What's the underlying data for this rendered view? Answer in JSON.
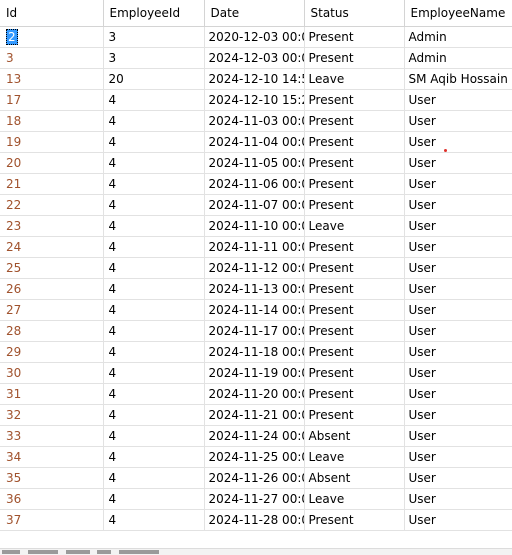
{
  "columns": {
    "id": "Id",
    "employee_id": "EmployeeId",
    "date": "Date",
    "status": "Status",
    "employee_name": "EmployeeName"
  },
  "selected_row": 0,
  "rows": [
    {
      "id": "2",
      "employee_id": "3",
      "date": "2020-12-03 00:0...",
      "status": "Present",
      "employee_name": "Admin"
    },
    {
      "id": "3",
      "employee_id": "3",
      "date": "2024-12-03 00:0...",
      "status": "Present",
      "employee_name": "Admin"
    },
    {
      "id": "13",
      "employee_id": "20",
      "date": "2024-12-10 14:5...",
      "status": "Leave",
      "employee_name": "SM Aqib Hossain"
    },
    {
      "id": "17",
      "employee_id": "4",
      "date": "2024-12-10 15:2...",
      "status": "Present",
      "employee_name": "User"
    },
    {
      "id": "18",
      "employee_id": "4",
      "date": "2024-11-03 00:0...",
      "status": "Present",
      "employee_name": "User"
    },
    {
      "id": "19",
      "employee_id": "4",
      "date": "2024-11-04 00:0...",
      "status": "Present",
      "employee_name": "User"
    },
    {
      "id": "20",
      "employee_id": "4",
      "date": "2024-11-05 00:0...",
      "status": "Present",
      "employee_name": "User"
    },
    {
      "id": "21",
      "employee_id": "4",
      "date": "2024-11-06 00:0...",
      "status": "Present",
      "employee_name": "User"
    },
    {
      "id": "22",
      "employee_id": "4",
      "date": "2024-11-07 00:0...",
      "status": "Present",
      "employee_name": "User"
    },
    {
      "id": "23",
      "employee_id": "4",
      "date": "2024-11-10 00:0...",
      "status": "Leave",
      "employee_name": "User"
    },
    {
      "id": "24",
      "employee_id": "4",
      "date": "2024-11-11 00:0...",
      "status": "Present",
      "employee_name": "User"
    },
    {
      "id": "25",
      "employee_id": "4",
      "date": "2024-11-12 00:0...",
      "status": "Present",
      "employee_name": "User"
    },
    {
      "id": "26",
      "employee_id": "4",
      "date": "2024-11-13 00:0...",
      "status": "Present",
      "employee_name": "User"
    },
    {
      "id": "27",
      "employee_id": "4",
      "date": "2024-11-14 00:0...",
      "status": "Present",
      "employee_name": "User"
    },
    {
      "id": "28",
      "employee_id": "4",
      "date": "2024-11-17 00:0...",
      "status": "Present",
      "employee_name": "User"
    },
    {
      "id": "29",
      "employee_id": "4",
      "date": "2024-11-18 00:0...",
      "status": "Present",
      "employee_name": "User"
    },
    {
      "id": "30",
      "employee_id": "4",
      "date": "2024-11-19 00:0...",
      "status": "Present",
      "employee_name": "User"
    },
    {
      "id": "31",
      "employee_id": "4",
      "date": "2024-11-20 00:0...",
      "status": "Present",
      "employee_name": "User"
    },
    {
      "id": "32",
      "employee_id": "4",
      "date": "2024-11-21 00:0...",
      "status": "Present",
      "employee_name": "User"
    },
    {
      "id": "33",
      "employee_id": "4",
      "date": "2024-11-24 00:0...",
      "status": "Absent",
      "employee_name": "User"
    },
    {
      "id": "34",
      "employee_id": "4",
      "date": "2024-11-25 00:0...",
      "status": "Leave",
      "employee_name": "User"
    },
    {
      "id": "35",
      "employee_id": "4",
      "date": "2024-11-26 00:0...",
      "status": "Absent",
      "employee_name": "User"
    },
    {
      "id": "36",
      "employee_id": "4",
      "date": "2024-11-27 00:0...",
      "status": "Leave",
      "employee_name": "User"
    },
    {
      "id": "37",
      "employee_id": "4",
      "date": "2024-11-28 00:0...",
      "status": "Present",
      "employee_name": "User"
    }
  ],
  "colors": {
    "id_text": "#a0522d",
    "selection": "#3399ff",
    "grid_line": "#e2e2e2",
    "marker": "#e0302a"
  }
}
